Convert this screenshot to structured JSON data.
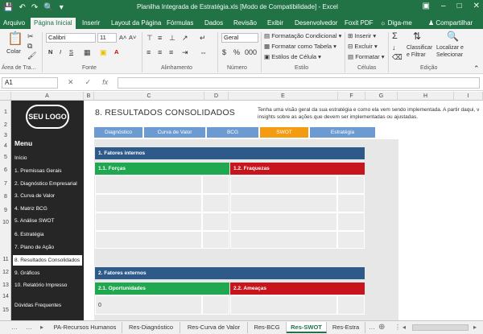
{
  "window": {
    "title": "Planilha Integrada de Estratégia.xls  [Modo de Compatibilidade] - Excel"
  },
  "ribbon_tabs": [
    "Arquivo",
    "Página Inicial",
    "Inserir",
    "Layout da Página",
    "Fórmulas",
    "Dados",
    "Revisão",
    "Exibir",
    "Desenvolvedor",
    "Foxit PDF"
  ],
  "tell_me": "Diga-me",
  "share": "Compartilhar",
  "ribbon": {
    "paste": "Colar",
    "font_name": "Calibri",
    "font_size": "11",
    "number_format": "Geral",
    "clipboard": "Área de Tra...",
    "font_group": "Fonte",
    "alignment_group": "Alinhamento",
    "number_group": "Número",
    "styles_group": "Estilo",
    "cells_group": "Células",
    "editing_group": "Edição",
    "cond_format": "Formatação Condicional",
    "format_table": "Formatar como Tabela",
    "cell_styles": "Estilos de Célula",
    "insert": "Inserir",
    "delete": "Excluir",
    "format": "Formatar",
    "sort_filter_1": "Classificar",
    "sort_filter_2": "e Filtrar",
    "find_select_1": "Localizar e",
    "find_select_2": "Selecionar",
    "bold": "N",
    "italic": "I",
    "underline": "S"
  },
  "formula_bar": {
    "name_box": "A1",
    "fx": "fx"
  },
  "columns": [
    "A",
    "B",
    "C",
    "D",
    "E",
    "F",
    "G",
    "H",
    "I"
  ],
  "rows": [
    "1",
    "2",
    "3",
    "4",
    "5",
    "6",
    "7",
    "8",
    "9",
    "10",
    "11",
    "12",
    "13",
    "14",
    "15"
  ],
  "sidebar": {
    "logo": "SEU LOGO",
    "menu_title": "Menu",
    "items": [
      "Início",
      "1. Premissas Gerais",
      "2. Diagnóstico Empresarial",
      "3. Curva de Valor",
      "4. Matriz BCG",
      "5. Análise SWOT",
      "6. Estratégia",
      "7. Plano de Ação",
      "8. Resultados Consolidados",
      "9. Gráficos",
      "10. Relatório Impresso",
      "Dúvidas Frequentes"
    ],
    "active_index": 8
  },
  "main": {
    "title": "8. RESULTADOS CONSOLIDADOS",
    "intro": "Tenha uma visão geral da sua estratégia e como ela vem sendo implementada. A partir daqui, v insights sobre as ações que devem ser implementadas ou ajustadas.",
    "nav_tabs": [
      "Diagnóstico",
      "Curva de Valor",
      "BCG",
      "SWOT",
      "Estratégia"
    ],
    "active_nav": "SWOT",
    "section1": "1. Fatores internos",
    "strengths": "1.1. Forças",
    "weaknesses": "1.2. Fraquezas",
    "section2": "2. Fatores externos",
    "opportunities": "2.1. Oportunidades",
    "threats": "2.2. Ameaças",
    "first_value": "0"
  },
  "sheet_tabs": [
    "PA-Recursos Humanos",
    "Res-Diagnóstico",
    "Res-Curva de Valor",
    "Res-BCG",
    "Res-SWOT",
    "Res-Estra"
  ],
  "active_sheet": "Res-SWOT",
  "colors": {
    "excel_green": "#217346",
    "nav_blue": "#6c9bd2",
    "nav_orange": "#f39c12",
    "section_blue": "#2e5a8a",
    "green": "#1fa84f",
    "red": "#c8151d"
  }
}
